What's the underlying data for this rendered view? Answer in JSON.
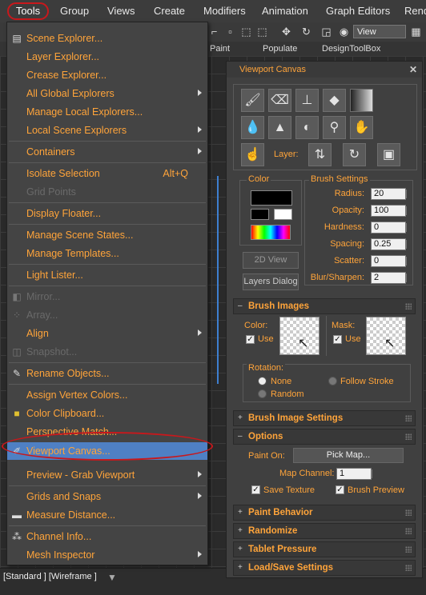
{
  "menubar": {
    "items": [
      "Tools",
      "Group",
      "Views",
      "Create",
      "Modifiers",
      "Animation",
      "Graph Editors",
      "Rend"
    ]
  },
  "toolbar": {
    "view_select": "View",
    "tabs": [
      "Paint",
      "Populate",
      "DesignToolBox"
    ]
  },
  "tools_menu": {
    "items": [
      {
        "label": "Scene Explorer...",
        "icon": "scene-explorer-icon"
      },
      {
        "label": "Layer Explorer..."
      },
      {
        "label": "Crease Explorer..."
      },
      {
        "label": "All Global Explorers",
        "submenu": true
      },
      {
        "label": "Manage Local Explorers..."
      },
      {
        "label": "Local Scene Explorers",
        "submenu": true
      },
      {
        "label": "Containers",
        "submenu": true
      },
      {
        "label": "Isolate Selection",
        "shortcut": "Alt+Q"
      },
      {
        "label": "Grid Points",
        "disabled": true
      },
      {
        "label": "Display Floater..."
      },
      {
        "label": "Manage Scene States..."
      },
      {
        "label": "Manage Templates..."
      },
      {
        "label": "Light Lister..."
      },
      {
        "label": "Mirror...",
        "disabled": true
      },
      {
        "label": "Array...",
        "disabled": true
      },
      {
        "label": "Align",
        "submenu": true
      },
      {
        "label": "Snapshot...",
        "disabled": true
      },
      {
        "label": "Rename Objects..."
      },
      {
        "label": "Assign Vertex Colors..."
      },
      {
        "label": "Color Clipboard..."
      },
      {
        "label": "Perspective Match..."
      },
      {
        "label": "Viewport Canvas..."
      },
      {
        "label": "Preview - Grab Viewport",
        "submenu": true
      },
      {
        "label": "Grids and Snaps",
        "submenu": true
      },
      {
        "label": "Measure Distance..."
      },
      {
        "label": "Channel Info..."
      },
      {
        "label": "Mesh Inspector",
        "submenu": true
      }
    ]
  },
  "panel": {
    "title": "Viewport Canvas",
    "close": "✕",
    "layer_label": "Layer:",
    "color_group": "Color",
    "brush_settings_group": "Brush Settings",
    "brush_settings": [
      {
        "label": "Radius:",
        "value": "20"
      },
      {
        "label": "Opacity:",
        "value": "100"
      },
      {
        "label": "Hardness:",
        "value": "0"
      },
      {
        "label": "Spacing:",
        "value": "0.25"
      },
      {
        "label": "Scatter:",
        "value": "0"
      },
      {
        "label": "Blur/Sharpen:",
        "value": "2"
      }
    ],
    "view_2d": "2D View",
    "layers_dialog": "Layers Dialog",
    "brush_images": {
      "title": "Brush Images",
      "color_label": "Color:",
      "mask_label": "Mask:",
      "use_label": "Use",
      "rotation_label": "Rotation:",
      "rotation_options": [
        "None",
        "Follow Stroke",
        "Random"
      ]
    },
    "brush_image_settings": "Brush Image Settings",
    "options": {
      "title": "Options",
      "paint_on_label": "Paint On:",
      "pick_map": "Pick Map...",
      "map_channel_label": "Map Channel:",
      "map_channel_value": "1",
      "save_texture": "Save Texture",
      "brush_preview": "Brush Preview"
    },
    "rollouts": [
      "Paint Behavior",
      "Randomize",
      "Tablet Pressure",
      "Load/Save Settings"
    ]
  },
  "status": {
    "text": "[Standard ] [Wireframe ]"
  },
  "colors": {
    "accent": "#ffa43a",
    "highlight": "#4f80c4",
    "annotation": "#c8181c"
  }
}
